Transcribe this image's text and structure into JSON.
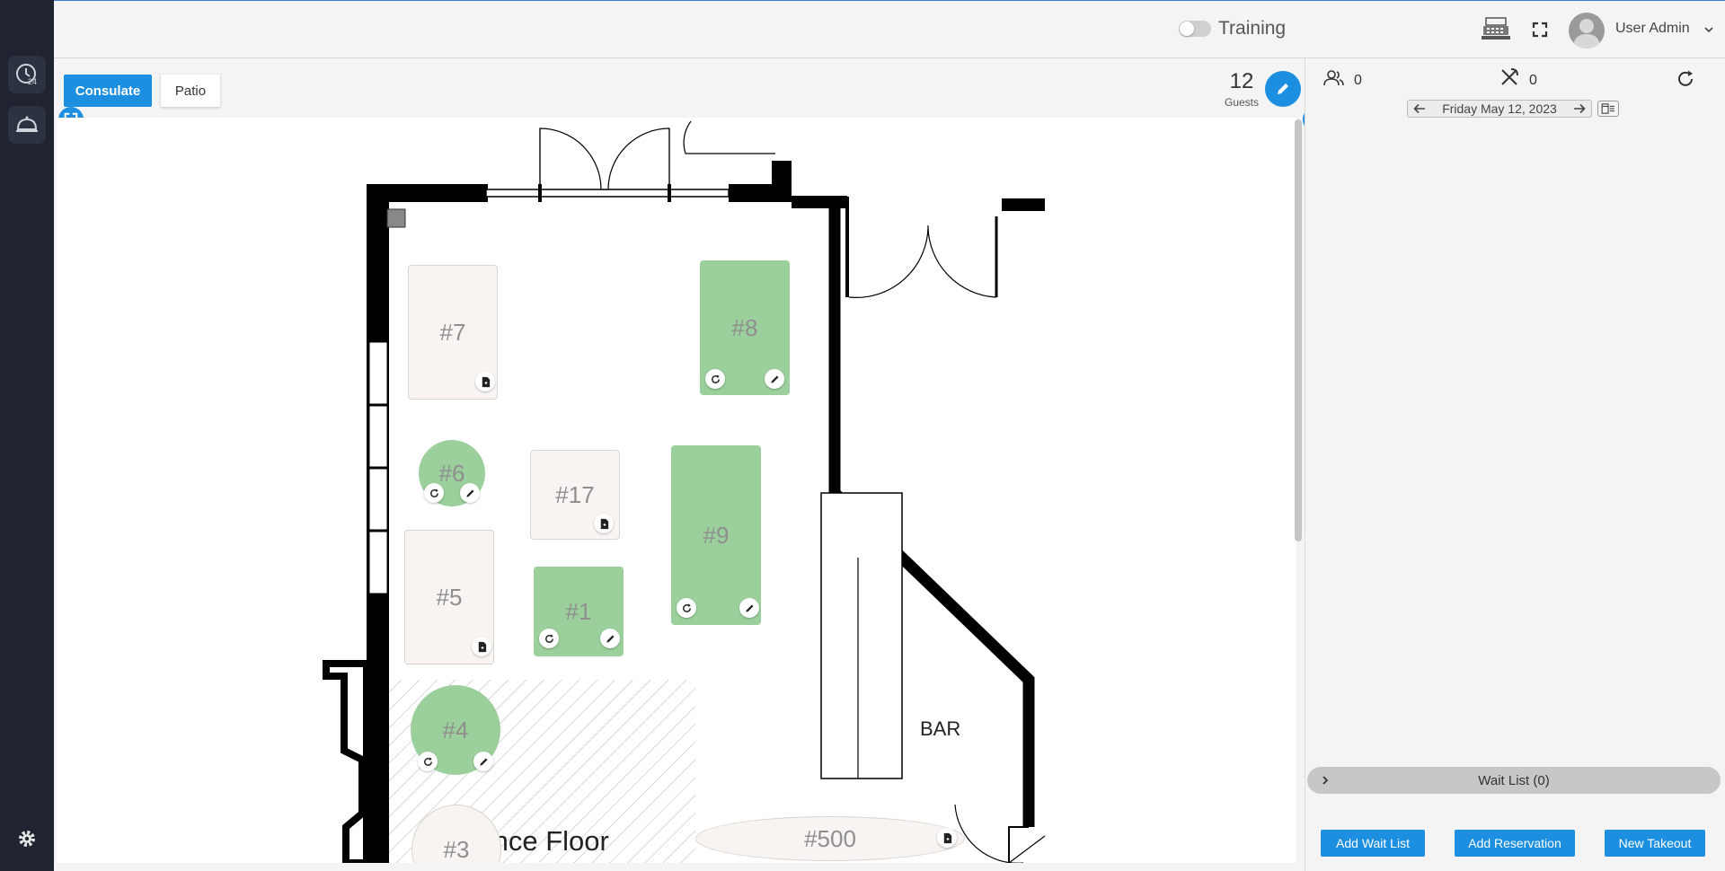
{
  "header": {
    "training_label": "Training",
    "training_enabled": false,
    "user_name": "User Admin",
    "icons": [
      "cash-register-icon",
      "fullscreen-icon",
      "chevron-down-icon"
    ]
  },
  "rail": {
    "items": [
      {
        "name": "clock-24-icon"
      },
      {
        "name": "cloche-icon"
      }
    ],
    "settings_icon": "gear-icon"
  },
  "floor": {
    "rooms": [
      {
        "label": "Consulate",
        "active": true
      },
      {
        "label": "Patio",
        "active": false
      }
    ],
    "guests_count": "12",
    "guests_label": "Guests",
    "bar_label": "BAR",
    "dance_floor_label": "Dance Floor",
    "tables": [
      {
        "label": "#7",
        "status": "free"
      },
      {
        "label": "#8",
        "status": "occupied"
      },
      {
        "label": "#6",
        "status": "occupied"
      },
      {
        "label": "#17",
        "status": "free"
      },
      {
        "label": "#9",
        "status": "occupied"
      },
      {
        "label": "#5",
        "status": "free"
      },
      {
        "label": "#1",
        "status": "occupied"
      },
      {
        "label": "#4",
        "status": "occupied"
      },
      {
        "label": "#3",
        "status": "free"
      },
      {
        "label": "#500",
        "status": "free"
      }
    ]
  },
  "side": {
    "guests_stat": "0",
    "covers_stat": "0",
    "date": "Friday May 12, 2023",
    "waitlist_label": "Wait List (0)",
    "buttons": {
      "add_wait_list": "Add Wait List",
      "add_reservation": "Add Reservation",
      "new_takeout": "New Takeout"
    }
  },
  "colors": {
    "accent": "#1d8fe0",
    "rail": "#1f2430",
    "occupied_table": "#9bcf9b",
    "free_table": "#f7f4f1"
  }
}
